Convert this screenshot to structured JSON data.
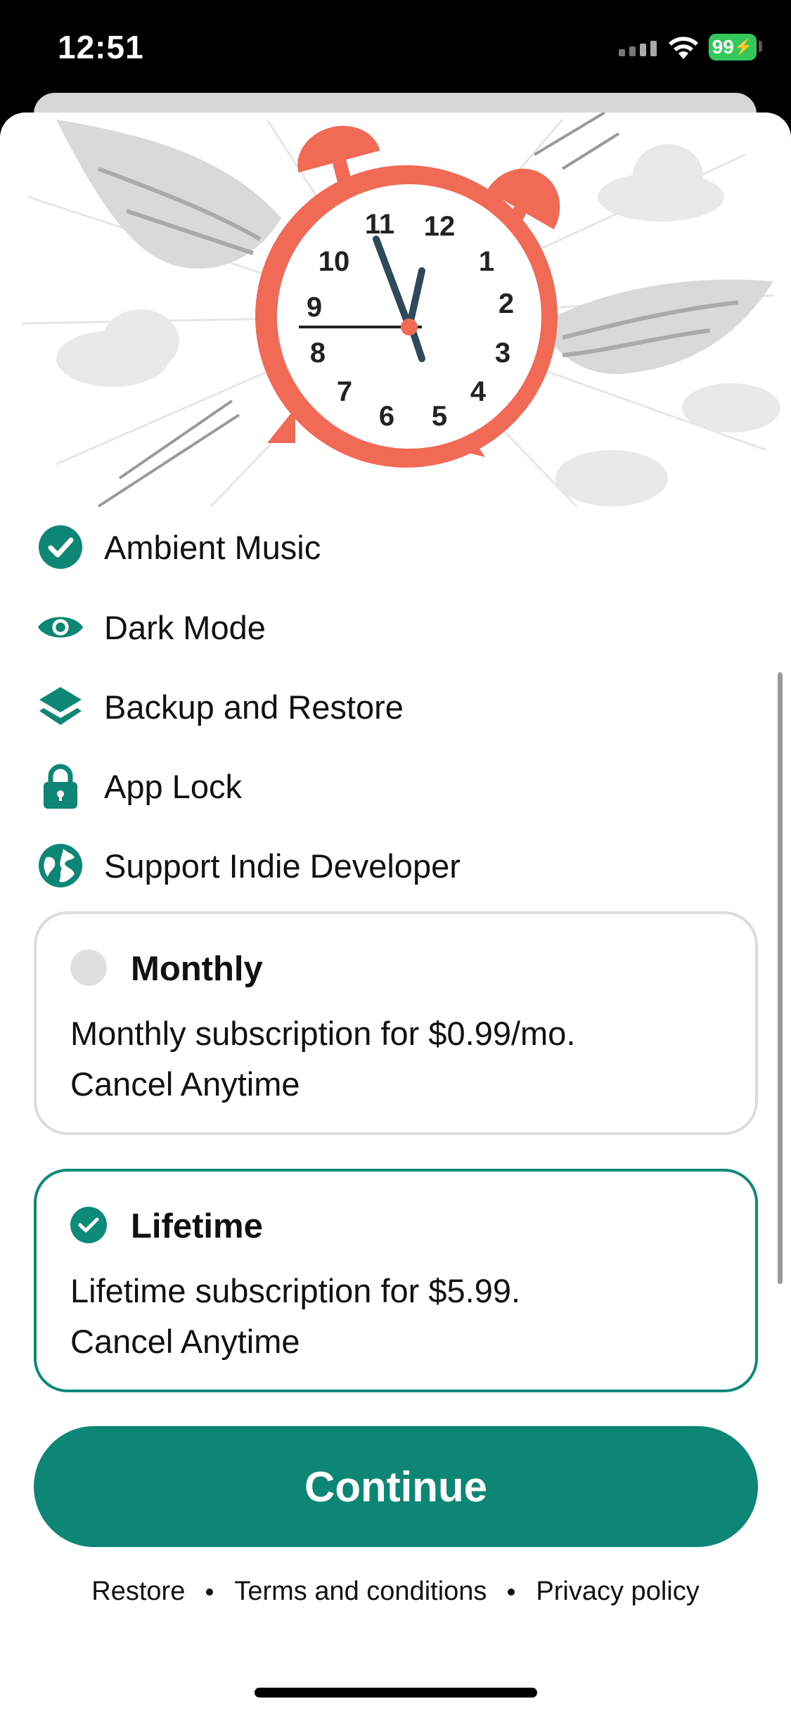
{
  "status_bar": {
    "time": "12:51",
    "battery": "99"
  },
  "features": [
    {
      "icon": "check-circle-icon",
      "label": "Ambient Music"
    },
    {
      "icon": "eye-icon",
      "label": "Dark Mode"
    },
    {
      "icon": "layers-icon",
      "label": "Backup and Restore"
    },
    {
      "icon": "lock-icon",
      "label": "App Lock"
    },
    {
      "icon": "globe-icon",
      "label": "Support Indie Developer"
    }
  ],
  "plans": {
    "monthly": {
      "title": "Monthly",
      "line1": "Monthly subscription for $0.99/mo.",
      "line2": "Cancel Anytime",
      "selected": false
    },
    "lifetime": {
      "title": "Lifetime",
      "line1": "Lifetime subscription for $5.99.",
      "line2": "Cancel Anytime",
      "selected": true
    }
  },
  "continue_label": "Continue",
  "footer": {
    "restore": "Restore",
    "terms": "Terms and conditions",
    "privacy": "Privacy policy"
  },
  "colors": {
    "accent": "#0e8676",
    "clock": "#f06a55",
    "battery": "#34c759"
  }
}
